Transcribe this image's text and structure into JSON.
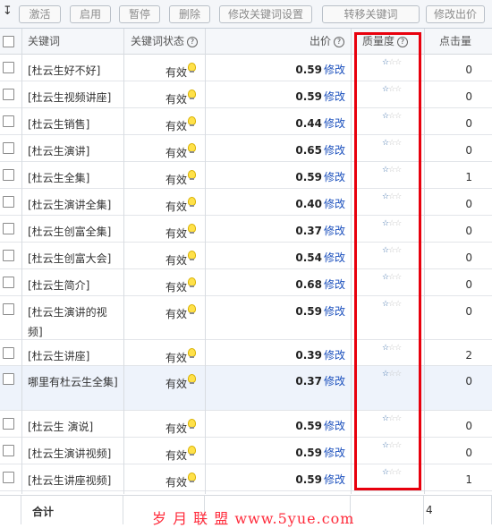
{
  "toolbar": {
    "arrow_icon": "sort-arrow-down-icon",
    "buttons": [
      "激活",
      "启用",
      "暂停",
      "删除",
      "修改关键词设置",
      "转移关键词",
      "修改出价"
    ]
  },
  "header": {
    "keyword": "关键词",
    "status": "关键词状态",
    "price": "出价",
    "quality": "质量度",
    "clicks": "点击量",
    "help_icon": "?"
  },
  "edit_label": "修改",
  "stars": {
    "filled": "☆",
    "empty": "☆",
    "filled_count": 1,
    "total": 3
  },
  "rows": [
    {
      "keyword": "[杜云生好不好]",
      "status": "有效",
      "price": "0.59",
      "clicks": "0"
    },
    {
      "keyword": "[杜云生视频讲座]",
      "status": "有效",
      "price": "0.59",
      "clicks": "0"
    },
    {
      "keyword": "[杜云生销售]",
      "status": "有效",
      "price": "0.44",
      "clicks": "0"
    },
    {
      "keyword": "[杜云生演讲]",
      "status": "有效",
      "price": "0.65",
      "clicks": "0"
    },
    {
      "keyword": "[杜云生全集]",
      "status": "有效",
      "price": "0.59",
      "clicks": "1"
    },
    {
      "keyword": "[杜云生演讲全集]",
      "status": "有效",
      "price": "0.40",
      "clicks": "0"
    },
    {
      "keyword": "[杜云生创富全集]",
      "status": "有效",
      "price": "0.37",
      "clicks": "0"
    },
    {
      "keyword": "[杜云生创富大会]",
      "status": "有效",
      "price": "0.54",
      "clicks": "0"
    },
    {
      "keyword": "[杜云生简介]",
      "status": "有效",
      "price": "0.68",
      "clicks": "0"
    },
    {
      "keyword": "[杜云生演讲的视频]",
      "status": "有效",
      "price": "0.59",
      "clicks": "0"
    },
    {
      "keyword": "[杜云生讲座]",
      "status": "有效",
      "price": "0.39",
      "clicks": "2"
    },
    {
      "keyword": "哪里有杜云生全集]",
      "status": "有效",
      "price": "0.37",
      "clicks": "0"
    },
    {
      "keyword": "[杜云生 演说]",
      "status": "有效",
      "price": "0.59",
      "clicks": "0"
    },
    {
      "keyword": "[杜云生演讲视频]",
      "status": "有效",
      "price": "0.59",
      "clicks": "0"
    },
    {
      "keyword": "[杜云生讲座视频]",
      "status": "有效",
      "price": "0.59",
      "clicks": "1"
    }
  ],
  "footer": {
    "total_label": "合计",
    "clicks_total": "4"
  },
  "watermark": "岁 月 联 盟  www.5yue.com",
  "colors": {
    "link": "#1a4fbd",
    "highlight_box": "#e8000d",
    "star_filled": "#3d6ea8",
    "star_empty": "#c4c4c4"
  }
}
